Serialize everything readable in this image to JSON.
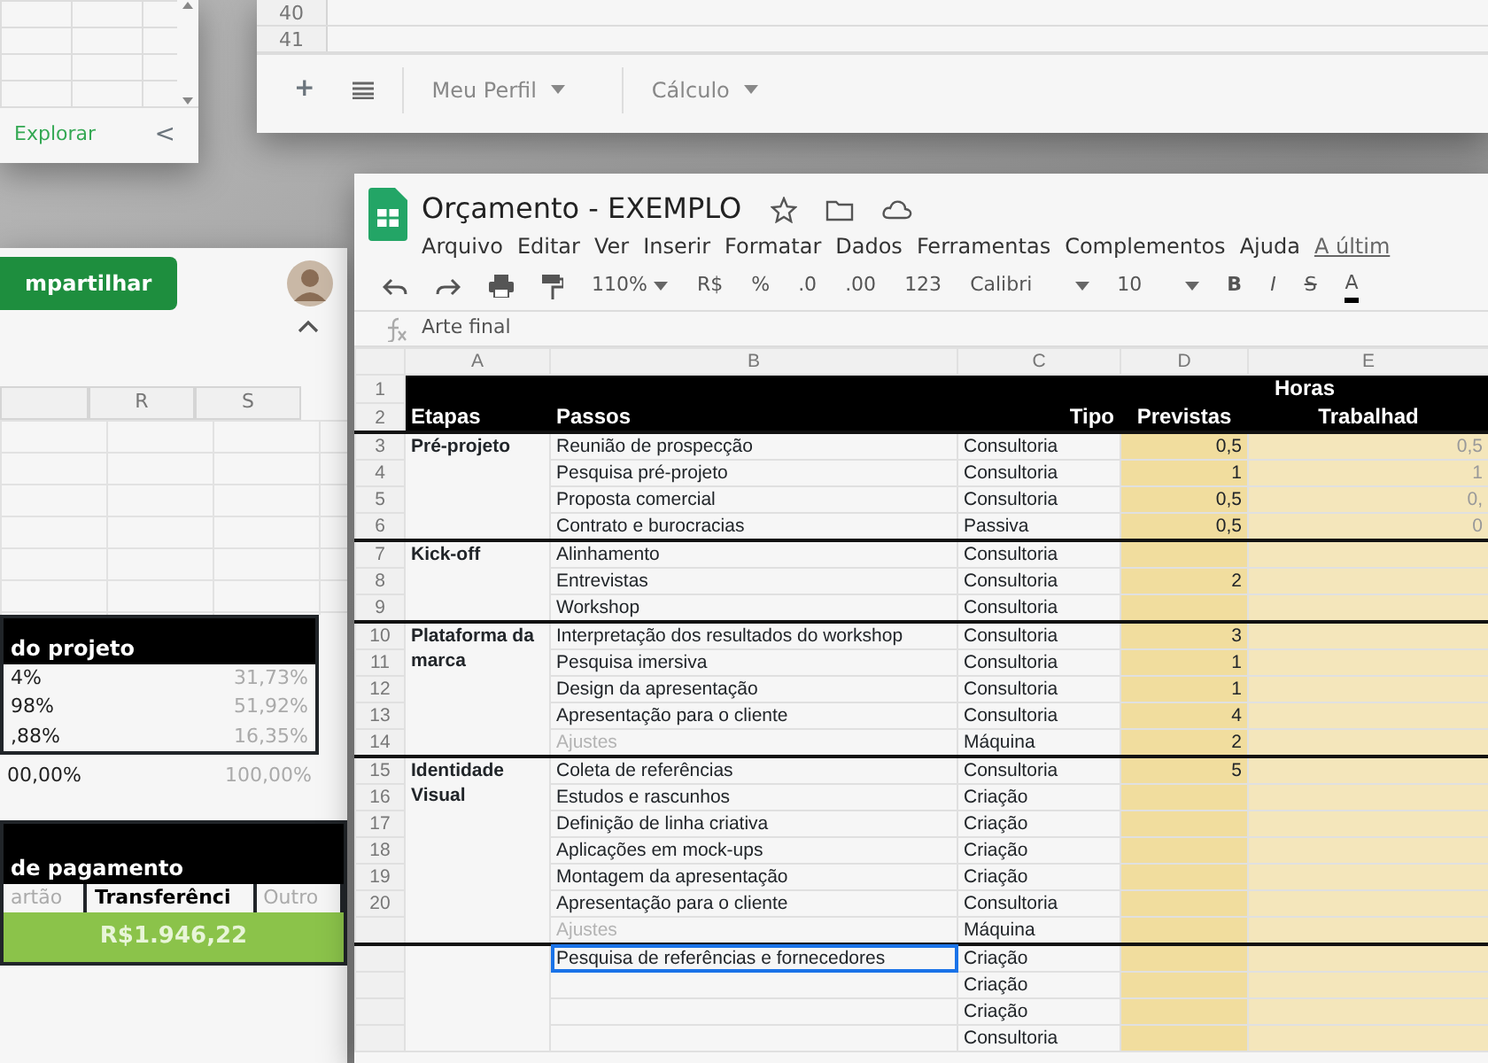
{
  "explore_panel": {
    "explore_label": "Explorar",
    "collapse_button": "<"
  },
  "sheet_tabs_panel": {
    "row_numbers": [
      "40",
      "41"
    ],
    "add_button": "+",
    "tabs": [
      {
        "label": "Meu Perfil",
        "selected": false
      },
      {
        "label": "Cálculo",
        "selected": false
      }
    ]
  },
  "summary_panel": {
    "share_button": "mpartilhar",
    "columns": [
      "R",
      "S"
    ],
    "project_table": {
      "title": "do projeto",
      "rows": [
        {
          "value": "4%",
          "share": "31,73%"
        },
        {
          "value": "98%",
          "share": "51,92%"
        },
        {
          "value": ",88%",
          "share": "16,35%"
        }
      ],
      "total": "00,00%",
      "total_share": "100,00%"
    },
    "payment_table": {
      "title": "de pagamento",
      "methods": [
        "artão",
        "Transferênci",
        "Outro"
      ],
      "amount": "R$1.946,22"
    }
  },
  "main": {
    "title": "Orçamento - EXEMPLO",
    "menu": [
      "Arquivo",
      "Editar",
      "Ver",
      "Inserir",
      "Formatar",
      "Dados",
      "Ferramentas",
      "Complementos",
      "Ajuda",
      "A últim"
    ],
    "toolbar": {
      "zoom": "110%",
      "currency": "R$",
      "percent": "%",
      "decrease_decimals": ".0",
      "increase_decimals": ".00",
      "format": "123",
      "font": "Calibri",
      "font_size": "10",
      "bold": "B",
      "italic": "I",
      "strike": "S",
      "text_color": "A"
    },
    "formula": "Arte final",
    "columns": [
      "A",
      "B",
      "C",
      "D",
      "E"
    ],
    "header": {
      "row_numbers": [
        "1",
        "2"
      ],
      "hours_group": "Horas",
      "stage": "Etapas",
      "step": "Passos",
      "type": "Tipo",
      "planned": "Previstas",
      "worked": "Trabalhad"
    },
    "groups": [
      {
        "stage": "Pré-projeto",
        "rows": [
          {
            "row": "3",
            "step": "Reunião de prospecção",
            "type": "Consultoria",
            "planned": "0,5",
            "worked": "0,5",
            "muted": false,
            "selected": false
          },
          {
            "row": "4",
            "step": "Pesquisa pré-projeto",
            "type": "Consultoria",
            "planned": "1",
            "worked": "1",
            "muted": false,
            "selected": false
          },
          {
            "row": "5",
            "step": "Proposta comercial",
            "type": "Consultoria",
            "planned": "0,5",
            "worked": "0,",
            "muted": false,
            "selected": false
          },
          {
            "row": "6",
            "step": "Contrato e burocracias",
            "type": "Passiva",
            "planned": "0,5",
            "worked": "0",
            "muted": false,
            "selected": false
          }
        ]
      },
      {
        "stage": "Kick-off",
        "rows": [
          {
            "row": "7",
            "step": "Alinhamento",
            "type": "Consultoria",
            "muted": false,
            "selected": false
          },
          {
            "row": "8",
            "step": "Entrevistas",
            "type": "Consultoria",
            "planned": "2",
            "muted": false,
            "selected": false
          },
          {
            "row": "9",
            "step": "Workshop",
            "type": "Consultoria",
            "muted": false,
            "selected": false
          }
        ]
      },
      {
        "stage": "Plataforma da marca",
        "rows": [
          {
            "row": "10",
            "step": "Interpretação dos resultados do workshop",
            "type": "Consultoria",
            "planned": "3",
            "muted": false,
            "selected": false
          },
          {
            "row": "11",
            "step": "Pesquisa imersiva",
            "type": "Consultoria",
            "planned": "1",
            "muted": false,
            "selected": false
          },
          {
            "row": "12",
            "step": "Design da apresentação",
            "type": "Consultoria",
            "planned": "1",
            "muted": false,
            "selected": false
          },
          {
            "row": "13",
            "step": "Apresentação para o cliente",
            "type": "Consultoria",
            "planned": "4",
            "muted": false,
            "selected": false
          },
          {
            "row": "14",
            "step": "Ajustes",
            "type": "Máquina",
            "planned": "2",
            "muted": true,
            "selected": false
          }
        ]
      },
      {
        "stage": "Identidade Visual",
        "rows": [
          {
            "row": "15",
            "step": "Coleta de referências",
            "type": "Consultoria",
            "planned": "5",
            "muted": false,
            "selected": false
          },
          {
            "row": "16",
            "step": "Estudos e rascunhos",
            "type": "Criação",
            "muted": false,
            "selected": false
          },
          {
            "row": "17",
            "step": "Definição de linha criativa",
            "type": "Criação",
            "muted": false,
            "selected": false
          },
          {
            "row": "18",
            "step": "Aplicações em mock-ups",
            "type": "Criação",
            "muted": false,
            "selected": false
          },
          {
            "row": "19",
            "step": "Montagem da apresentação",
            "type": "Criação",
            "muted": false,
            "selected": false
          },
          {
            "row": "20",
            "step": "Apresentação para o cliente",
            "type": "Consultoria",
            "muted": false,
            "selected": false
          },
          {
            "step": "Ajustes",
            "type": "Máquina",
            "muted": true,
            "selected": false
          }
        ]
      },
      {
        "rows": [
          {
            "step": "Pesquisa de referências e fornecedores",
            "type": "Criação",
            "muted": false,
            "selected": true
          },
          {
            "type": "Criação",
            "selected": false
          },
          {
            "type": "Criação",
            "selected": false
          },
          {
            "type": "Consultoria",
            "selected": false
          }
        ]
      }
    ]
  }
}
